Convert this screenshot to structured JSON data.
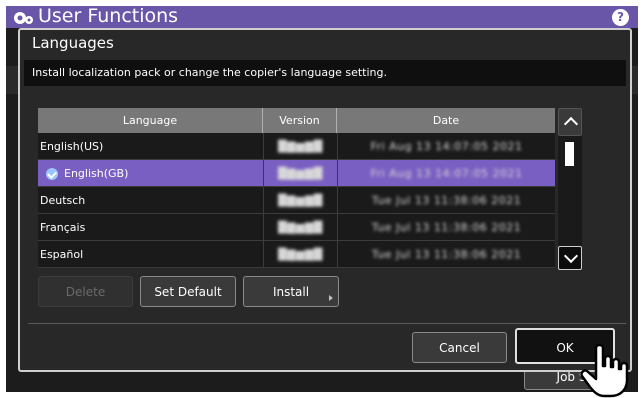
{
  "app": {
    "title": "User Functions",
    "help_label": "?",
    "bg_button_label": "Job S"
  },
  "dialog": {
    "title": "Languages",
    "description": "Install localization pack or change the copier's language setting."
  },
  "table": {
    "headers": [
      "Language",
      "Version",
      "Date"
    ],
    "rows": [
      {
        "language": "English(US)",
        "version": "█▇▆▇█",
        "date": "Fri Aug 13 14:07:05 2021",
        "selected": false
      },
      {
        "language": "English(GB)",
        "version": "█▇▆▇█",
        "date": "Fri Aug 13 14:07:05 2021",
        "selected": true
      },
      {
        "language": "Deutsch",
        "version": "█▇▆▇█",
        "date": "Tue Jul 13 11:38:06 2021",
        "selected": false
      },
      {
        "language": "Français",
        "version": "█▇▆▇█",
        "date": "Tue Jul 13 11:38:06 2021",
        "selected": false
      },
      {
        "language": "Español",
        "version": "█▇▆▇█",
        "date": "Tue Jul 13 11:38:06 2021",
        "selected": false
      }
    ]
  },
  "buttons": {
    "delete": "Delete",
    "set_default": "Set Default",
    "install": "Install",
    "cancel": "Cancel",
    "ok": "OK"
  },
  "colors": {
    "accent": "#6a56a8",
    "selected_row": "#7a5fc2"
  }
}
